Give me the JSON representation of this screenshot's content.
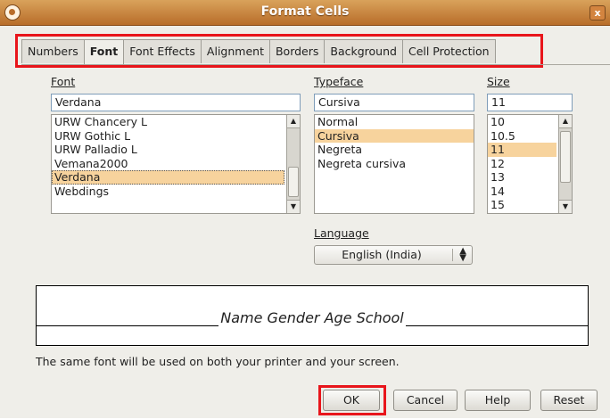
{
  "window": {
    "title": "Format Cells",
    "close_glyph": "x"
  },
  "tabs": [
    {
      "label": "Numbers",
      "active": false
    },
    {
      "label": "Font",
      "active": true
    },
    {
      "label": "Font Effects",
      "active": false
    },
    {
      "label": "Alignment",
      "active": false
    },
    {
      "label": "Borders",
      "active": false
    },
    {
      "label": "Background",
      "active": false
    },
    {
      "label": "Cell Protection",
      "active": false
    }
  ],
  "font": {
    "label": "Font",
    "value": "Verdana",
    "items": [
      "URW Chancery L",
      "URW Gothic L",
      "URW Palladio L",
      "Vemana2000",
      "Verdana",
      "Webdings"
    ]
  },
  "typeface": {
    "label": "Typeface",
    "value": "Cursiva",
    "items": [
      "Normal",
      "Cursiva",
      "Negreta",
      "Negreta cursiva"
    ]
  },
  "size": {
    "label": "Size",
    "value": "11",
    "items": [
      "10",
      "10.5",
      "11",
      "12",
      "13",
      "14",
      "15"
    ]
  },
  "language": {
    "label": "Language",
    "value": "English (India)"
  },
  "preview": {
    "text": "Name Gender Age School"
  },
  "info_text": "The same font will be used on both your printer and your screen.",
  "buttons": {
    "ok": "OK",
    "cancel": "Cancel",
    "help": "Help",
    "reset": "Reset"
  },
  "colors": {
    "highlight": "#e8151b",
    "selection": "#f7d39d",
    "titlebar": "#c8813d"
  }
}
